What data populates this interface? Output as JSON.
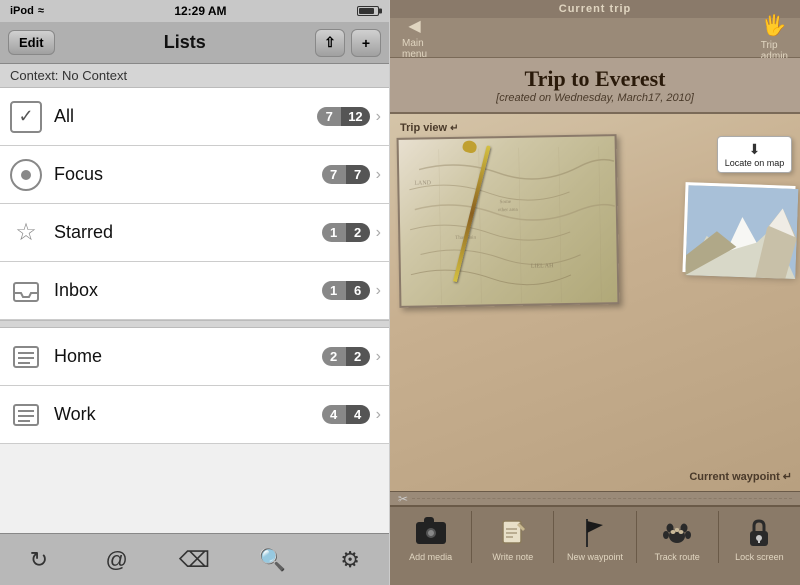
{
  "statusBar": {
    "carrier": "iPod",
    "time": "12:29 AM",
    "wifiSymbol": "📶"
  },
  "navBar": {
    "editLabel": "Edit",
    "title": "Lists",
    "addContextLabel": "⇧+",
    "addLabel": "+"
  },
  "contextBar": {
    "label": "Context: No Context"
  },
  "listItems": [
    {
      "id": "all",
      "iconType": "check",
      "label": "All",
      "badgeLeft": "7",
      "badgeRight": "12"
    },
    {
      "id": "focus",
      "iconType": "target",
      "label": "Focus",
      "badgeLeft": "7",
      "badgeRight": "7"
    },
    {
      "id": "starred",
      "iconType": "star",
      "label": "Starred",
      "badgeLeft": "1",
      "badgeRight": "2"
    },
    {
      "id": "inbox",
      "iconType": "inbox",
      "label": "Inbox",
      "badgeLeft": "1",
      "badgeRight": "6"
    },
    {
      "id": "home",
      "iconType": "list",
      "label": "Home",
      "badgeLeft": "2",
      "badgeRight": "2"
    },
    {
      "id": "work",
      "iconType": "list",
      "label": "Work",
      "badgeLeft": "4",
      "badgeRight": "4"
    }
  ],
  "bottomToolbar": {
    "refresh": "↻",
    "at": "@",
    "tag": "⌫",
    "search": "🔍",
    "settings": "⚙"
  },
  "tripApp": {
    "topLabel": "Current trip",
    "backLabel": "Main\nmenu",
    "forwardLabel": "Trip\nadmin",
    "title": "Trip to Everest",
    "subtitle": "[created on Wednesday, March17, 2010]",
    "tripViewLabel": "Trip view",
    "locateBtnLabel": "Locate\non map",
    "currentWaypointLabel": "Current waypoint",
    "scissors": "✂",
    "actions": [
      {
        "id": "add-media",
        "iconType": "camera",
        "label": "Add media"
      },
      {
        "id": "write-note",
        "iconType": "note",
        "label": "Write note"
      },
      {
        "id": "new-waypoint",
        "iconType": "flag",
        "label": "New waypoint"
      },
      {
        "id": "track-route",
        "iconType": "paw",
        "label": "Track route"
      },
      {
        "id": "lock-screen",
        "iconType": "lock",
        "label": "Lock screen"
      }
    ]
  }
}
